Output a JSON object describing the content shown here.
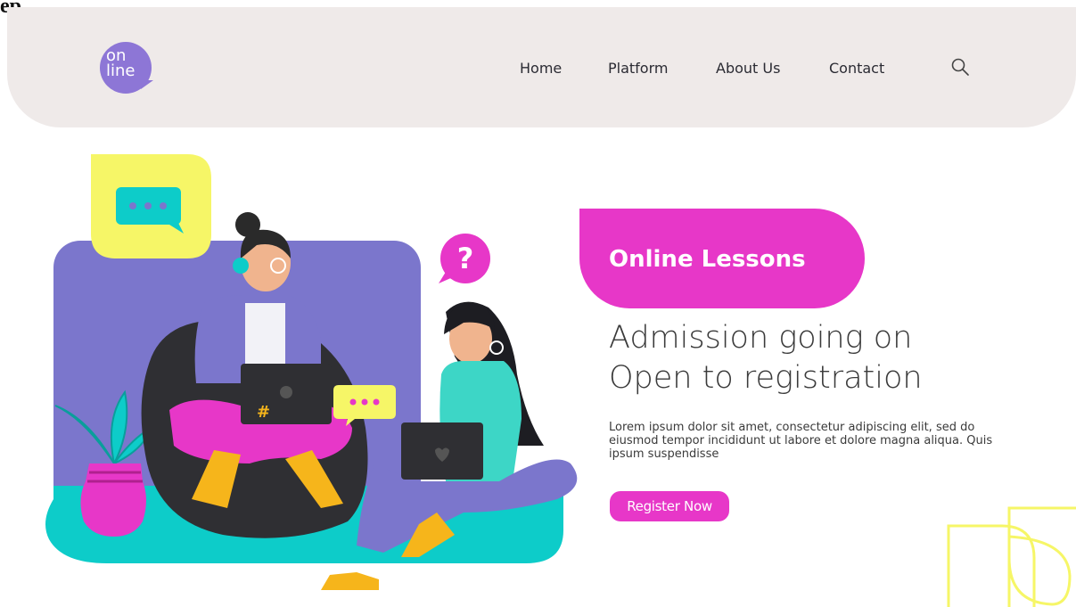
{
  "corner_label": "ep",
  "logo": {
    "line1": "on",
    "line2": "line"
  },
  "nav": {
    "items": [
      {
        "label": "Home"
      },
      {
        "label": "Platform"
      },
      {
        "label": "About Us"
      },
      {
        "label": "Contact"
      }
    ],
    "search_icon": "search-icon"
  },
  "hero": {
    "badge": "Online Lessons",
    "headline_line1": "Admission going on",
    "headline_line2": "Open to registration",
    "body": "Lorem ipsum dolor sit amet, consectetur adipiscing elit, sed do eiusmod tempor incididunt ut labore et dolore magna aliqua. Quis ipsum suspendisse",
    "cta": "Register Now"
  },
  "illustration": {
    "laptop_symbol": "#",
    "question_symbol": "?"
  },
  "colors": {
    "header_bg": "#efeae9",
    "accent_pink": "#e737c8",
    "logo_purple": "#8d76d6",
    "backdrop_purple": "#7b76cc",
    "floor_teal": "#0dccc9",
    "yellow": "#f6f667"
  }
}
